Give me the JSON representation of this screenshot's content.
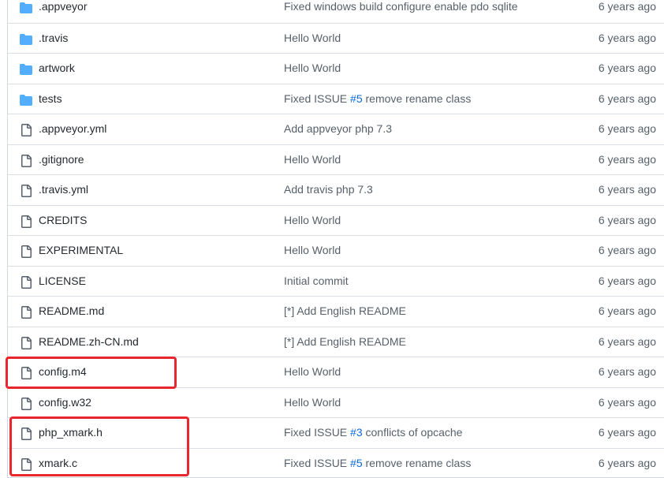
{
  "colors": {
    "folder": "#54aeff",
    "file": "#57606a",
    "link": "#0969da",
    "highlight": "#e8262e"
  },
  "files": [
    {
      "type": "folder",
      "icon": "folder-icon",
      "name": ".appveyor",
      "message": "Fixed windows build configure enable pdo sqlite",
      "age": "6 years ago"
    },
    {
      "type": "folder",
      "icon": "folder-icon",
      "name": ".travis",
      "message": "Hello World",
      "age": "6 years ago"
    },
    {
      "type": "folder",
      "icon": "folder-icon",
      "name": "artwork",
      "message": "Hello World",
      "age": "6 years ago"
    },
    {
      "type": "folder",
      "icon": "folder-icon",
      "name": "tests",
      "message_pre": "Fixed ISSUE ",
      "issue": "#5",
      "message_post": " remove rename class",
      "age": "6 years ago"
    },
    {
      "type": "file",
      "icon": "file-icon",
      "name": ".appveyor.yml",
      "message": "Add appveyor php 7.3",
      "age": "6 years ago"
    },
    {
      "type": "file",
      "icon": "file-icon",
      "name": ".gitignore",
      "message": "Hello World",
      "age": "6 years ago"
    },
    {
      "type": "file",
      "icon": "file-icon",
      "name": ".travis.yml",
      "message": "Add travis php 7.3",
      "age": "6 years ago"
    },
    {
      "type": "file",
      "icon": "file-icon",
      "name": "CREDITS",
      "message": "Hello World",
      "age": "6 years ago"
    },
    {
      "type": "file",
      "icon": "file-icon",
      "name": "EXPERIMENTAL",
      "message": "Hello World",
      "age": "6 years ago"
    },
    {
      "type": "file",
      "icon": "file-icon",
      "name": "LICENSE",
      "message": "Initial commit",
      "age": "6 years ago"
    },
    {
      "type": "file",
      "icon": "file-icon",
      "name": "README.md",
      "message": "[*] Add English README",
      "age": "6 years ago"
    },
    {
      "type": "file",
      "icon": "file-icon",
      "name": "README.zh-CN.md",
      "message": "[*] Add English README",
      "age": "6 years ago"
    },
    {
      "type": "file",
      "icon": "file-icon",
      "name": "config.m4",
      "message": "Hello World",
      "age": "6 years ago"
    },
    {
      "type": "file",
      "icon": "file-icon",
      "name": "config.w32",
      "message": "Hello World",
      "age": "6 years ago"
    },
    {
      "type": "file",
      "icon": "file-icon",
      "name": "php_xmark.h",
      "message_pre": "Fixed ISSUE ",
      "issue": "#3",
      "message_post": " conflicts of opcache",
      "age": "6 years ago"
    },
    {
      "type": "file",
      "icon": "file-icon",
      "name": "xmark.c",
      "message_pre": "Fixed ISSUE ",
      "issue": "#5",
      "message_post": " remove rename class",
      "age": "6 years ago"
    }
  ]
}
